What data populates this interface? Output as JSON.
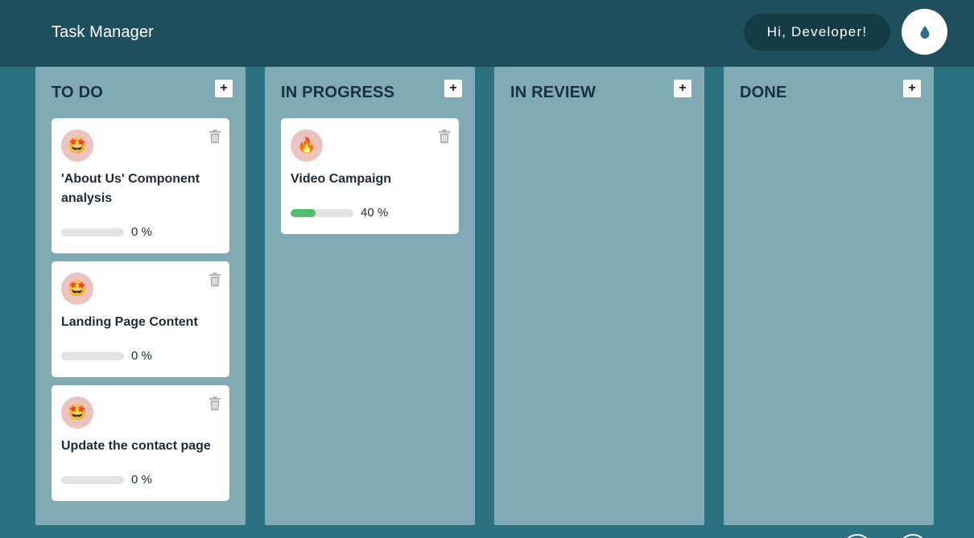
{
  "header": {
    "title": "Task Manager",
    "greeting": "Hi, Developer!",
    "theme_icon": "water-drop-icon",
    "theme_color": "#2a7282"
  },
  "columns": [
    {
      "title": "TO DO",
      "add_label": "+",
      "cards": [
        {
          "emoji": "🤩",
          "title": "'About Us' Component analysis",
          "progress": 0,
          "progress_text": "0 %"
        },
        {
          "emoji": "🤩",
          "title": "Landing Page Content",
          "progress": 0,
          "progress_text": "0 %"
        },
        {
          "emoji": "🤩",
          "title": "Update the contact page",
          "progress": 0,
          "progress_text": "0 %"
        }
      ]
    },
    {
      "title": "IN PROGRESS",
      "add_label": "+",
      "cards": [
        {
          "emoji": "🔥",
          "title": "Video Campaign",
          "progress": 40,
          "progress_text": "40 %"
        }
      ]
    },
    {
      "title": "IN REVIEW",
      "add_label": "+",
      "cards": []
    },
    {
      "title": "DONE",
      "add_label": "+",
      "cards": []
    }
  ],
  "colors": {
    "header_bg": "#1f4f5d",
    "column_bg": "#80abb4",
    "progress_fill": "#4fbf6f"
  }
}
